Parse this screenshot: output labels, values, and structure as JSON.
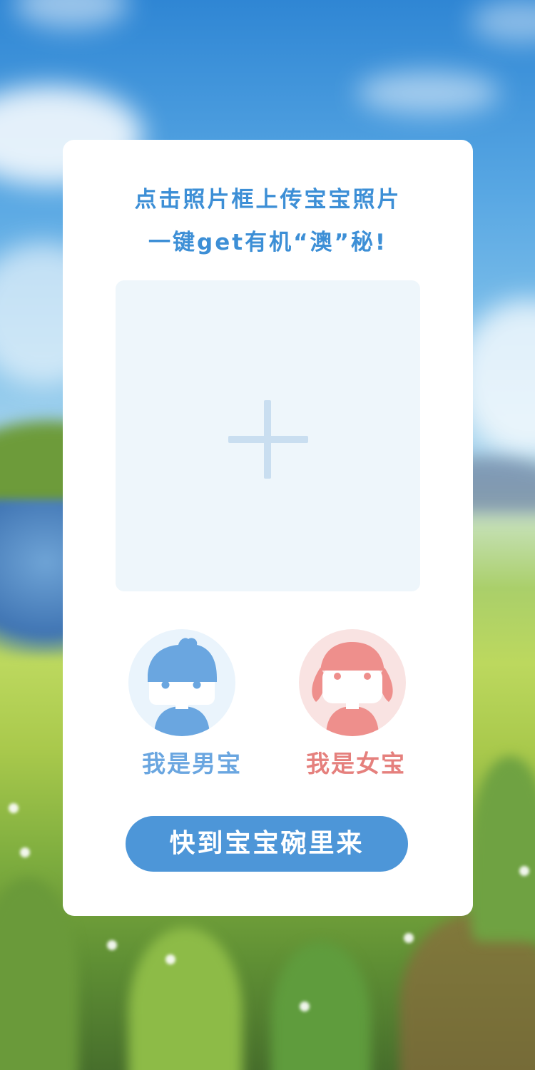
{
  "card": {
    "headline_line1": "点击照片框上传宝宝照片",
    "headline_line2": "一键get有机“澳”秘!"
  },
  "upload": {
    "icon": "plus-icon"
  },
  "gender": {
    "boy_label": "我是男宝",
    "girl_label": "我是女宝",
    "boy_icon": "boy-avatar-icon",
    "girl_icon": "girl-avatar-icon"
  },
  "cta": {
    "label": "快到宝宝碗里来"
  },
  "colors": {
    "accent_blue": "#4d96d8",
    "boy_blue": "#6aa6e0",
    "girl_pink": "#e5807d",
    "upload_bg": "#eef6fb"
  }
}
